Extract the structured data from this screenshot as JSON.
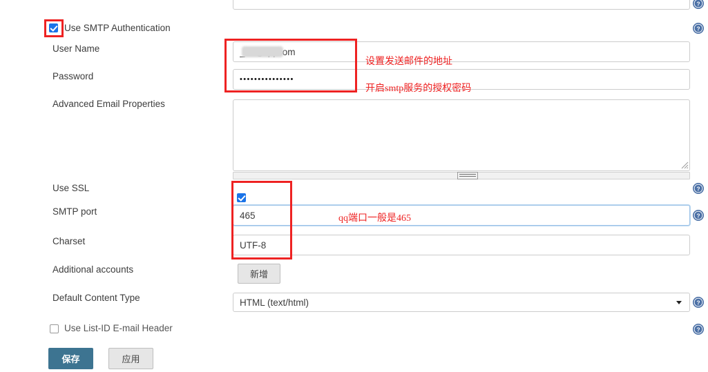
{
  "form": {
    "checkbox_smtp_auth": {
      "label": "Use SMTP Authentication",
      "checked": true
    },
    "labels": {
      "user_name": "User Name",
      "password": "Password",
      "advanced_email_properties": "Advanced Email Properties",
      "use_ssl": "Use SSL",
      "smtp_port": "SMTP port",
      "charset": "Charset",
      "additional_accounts": "Additional accounts",
      "default_content_type": "Default Content Type"
    },
    "values": {
      "user_name": "_46@qq.com",
      "password_mask": "•••••••••••••••",
      "advanced_email_properties": "",
      "smtp_port": "465",
      "charset": "UTF-8",
      "default_content_type": "HTML (text/html)"
    },
    "placeholders": {
      "user_name": "",
      "password": "",
      "advanced_email_properties": "",
      "smtp_port": "",
      "charset": ""
    },
    "checkbox_use_ssl": {
      "checked": true
    },
    "checkbox_list_id": {
      "label": "Use List-ID E-mail Header",
      "checked": false
    },
    "buttons": {
      "additional_accounts_add": "新增",
      "save": "保存",
      "apply": "应用"
    },
    "content_type_options": [
      "HTML (text/html)"
    ]
  },
  "annotations": [
    {
      "id": "note-sender-address",
      "text": "设置发送邮件的地址"
    },
    {
      "id": "note-smtp-auth-code",
      "text": "开启smtp服务的授权密码"
    },
    {
      "id": "note-qq-port",
      "text": "qq端口一般是465"
    }
  ],
  "icons": {
    "help": "help-icon",
    "checkmark": "check-icon",
    "chevron_down": "chevron-down-icon",
    "resize_grip": "resize-grip-icon"
  },
  "colors": {
    "annotation_red": "#ee2222",
    "primary_button": "#3d7491",
    "checkbox_checked": "#1a73e8",
    "help_icon": "#4a6fa5",
    "focus_ring": "#9cc3e8"
  }
}
